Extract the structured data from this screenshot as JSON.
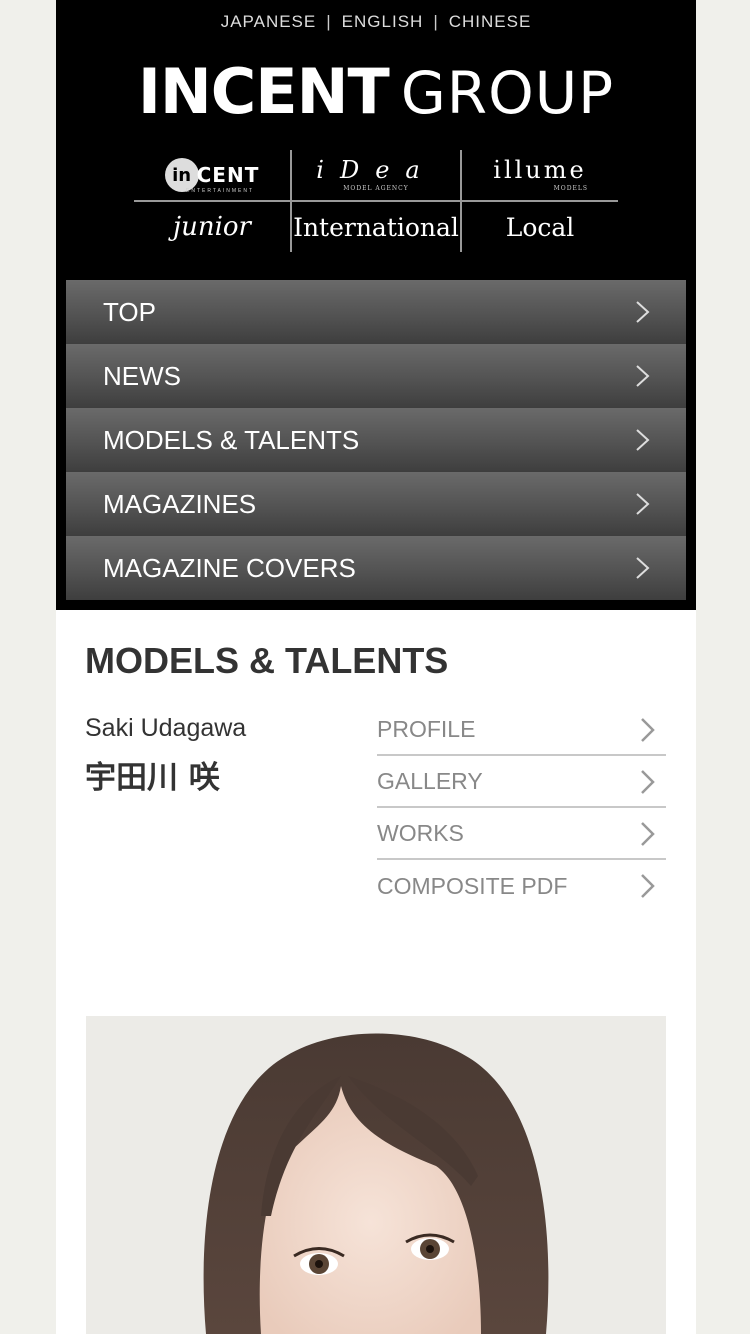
{
  "lang_bar": {
    "japanese": "JAPANESE",
    "english": "ENGLISH",
    "chinese": "CHINESE",
    "separator": "|"
  },
  "logo": {
    "part1": "INCENT",
    "part2": "GROUP"
  },
  "brands": {
    "incent": {
      "mark": "in",
      "word": "CENT",
      "sub": "ENTERTAINMENT"
    },
    "idea": {
      "word": "iDea",
      "sub": "MODEL AGENCY"
    },
    "illume": {
      "word": "illume",
      "sub": "MODELS"
    },
    "junior": "junior",
    "international": "International",
    "local": "Local"
  },
  "nav": {
    "items": [
      {
        "label": "TOP"
      },
      {
        "label": "NEWS"
      },
      {
        "label": "MODELS & TALENTS"
      },
      {
        "label": "MAGAZINES"
      },
      {
        "label": "MAGAZINE COVERS"
      }
    ]
  },
  "section": {
    "title": "MODELS & TALENTS",
    "name_en": "Saki Udagawa",
    "name_jp": "宇田川 咲"
  },
  "sub_links": [
    {
      "label": "PROFILE"
    },
    {
      "label": "GALLERY"
    },
    {
      "label": "WORKS"
    },
    {
      "label": "COMPOSITE PDF"
    }
  ],
  "icons": {
    "nav_chevron": "chevron-right-icon",
    "link_chevron": "chevron-right-icon"
  },
  "colors": {
    "header_bg": "#000000",
    "nav_bg_top": "#6a6a6a",
    "nav_bg_bottom": "#3e3e3e",
    "link_text": "#888888",
    "page_bg": "#f0f0eb"
  }
}
